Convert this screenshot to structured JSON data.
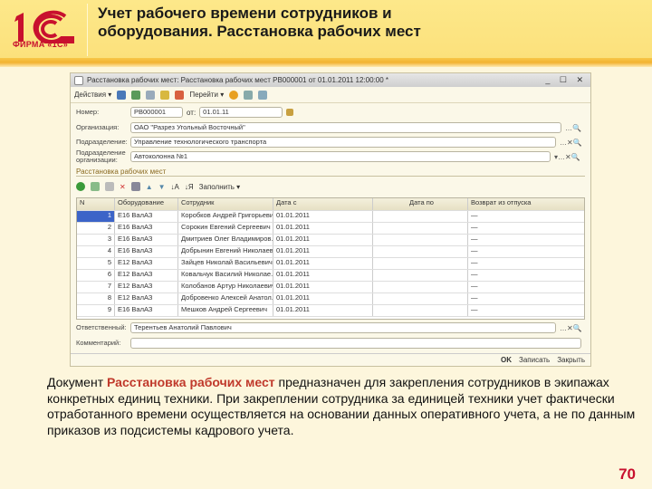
{
  "slide": {
    "title": "Учет рабочего времени сотрудников и оборудования. Расстановка рабочих мест",
    "logo_text": "ФИРМА «1С»",
    "page_number": "70",
    "desc_before": "Документ ",
    "desc_highlight": "Расстановка рабочих мест",
    "desc_after": " предназначен для закрепления сотрудников в экипажах конкретных единиц техники. При закреплении сотрудника за единицей техники учет фактически отработанного времени осуществляется на основании данных оперативного учета, а не по данным приказов из подсистемы кадрового учета."
  },
  "window": {
    "title": "Расстановка рабочих мест: Расстановка рабочих мест РВ000001 от 01.01.2011 12:00:00 *",
    "toolbar": {
      "actions": "Действия",
      "goto": "Перейти"
    },
    "fields": {
      "number_label": "Номер:",
      "number": "РВ000001",
      "from_label": "от:",
      "date": "01.01.11",
      "org_label": "Организация:",
      "org": "ОАО \"Разрез Угольный Восточный\"",
      "dept_label": "Подразделение:",
      "dept": "Управление технологического транспорта",
      "dept_org_label": "Подразделение организации:",
      "dept_org": "Автоколонна №1"
    },
    "section": "Расстановка рабочих мест",
    "fill_label": "Заполнить",
    "columns": [
      "N",
      "Оборудование",
      "Сотрудник",
      "Дата с",
      "Дата по",
      "Возврат из отпуска"
    ],
    "rows": [
      {
        "n": "1",
        "eq": "Е16 ВалАЗ",
        "emp": "Коробков Андрей Григорьевич",
        "date": "01.01.2011"
      },
      {
        "n": "2",
        "eq": "Е16 ВалАЗ",
        "emp": "Сорокин Евгений Сергеевич",
        "date": "01.01.2011"
      },
      {
        "n": "3",
        "eq": "Е16 ВалАЗ",
        "emp": "Дмитриев Олег Владимиров...",
        "date": "01.01.2011"
      },
      {
        "n": "4",
        "eq": "Е16 ВалАЗ",
        "emp": "Добрынин Евгений Николаев...",
        "date": "01.01.2011"
      },
      {
        "n": "5",
        "eq": "Е12 ВалАЗ",
        "emp": "Зайцев Николай Васильевич",
        "date": "01.01.2011"
      },
      {
        "n": "6",
        "eq": "Е12 ВалАЗ",
        "emp": "Ковальчук Василий Николае...",
        "date": "01.01.2011"
      },
      {
        "n": "7",
        "eq": "Е12 ВалАЗ",
        "emp": "Колобанов Артур Николаевич",
        "date": "01.01.2011"
      },
      {
        "n": "8",
        "eq": "Е12 ВалАЗ",
        "emp": "Добровенко Алексей Анатол...",
        "date": "01.01.2011"
      },
      {
        "n": "9",
        "eq": "Е16 ВалАЗ",
        "emp": "Мешков Андрей Сергеевич",
        "date": "01.01.2011"
      }
    ],
    "responsible_label": "Ответственный:",
    "responsible": "Терентьев Анатолий Павлович",
    "comment_label": "Комментарий:",
    "comment": "",
    "ok": "OK",
    "save": "Записать",
    "close": "Закрыть"
  }
}
